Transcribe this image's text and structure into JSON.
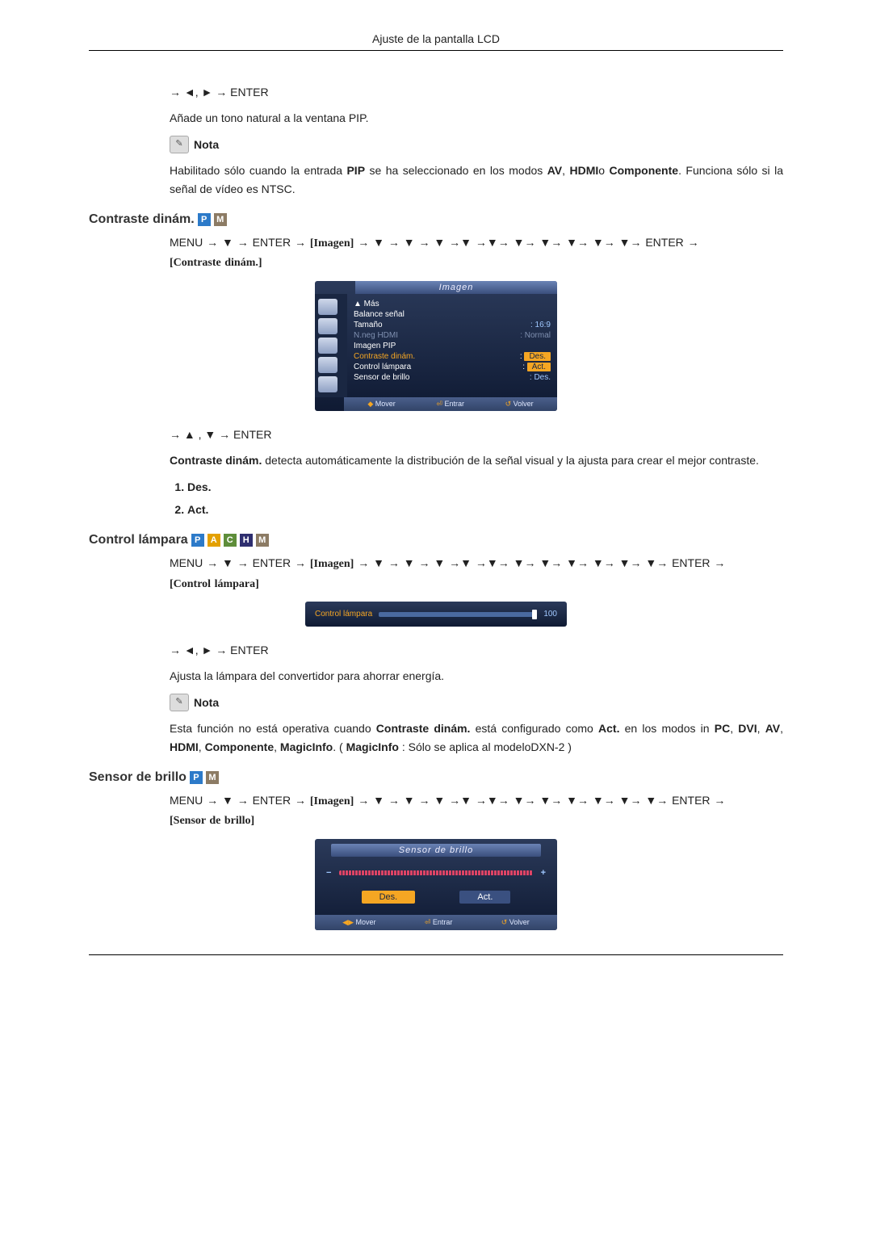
{
  "header": {
    "title": "Ajuste de la pantalla LCD"
  },
  "s0": {
    "nav": "→ ◄, ► → ENTER",
    "desc": "Añade un tono natural a la ventana PIP.",
    "note_label": "Nota",
    "note_body_1": "Habilitado sólo cuando la entrada ",
    "note_b1": "PIP",
    "note_body_2": " se ha seleccionado en los modos ",
    "note_b2": "AV",
    "note_body_3": ", ",
    "note_b3": "HDMI",
    "note_body_4": "o ",
    "note_b4": "Componente",
    "note_body_5": ". Funciona sólo si la señal de vídeo es NTSC."
  },
  "s1": {
    "heading": "Contraste dinám.",
    "path_pre": "MENU → ▼ → ENTER → ",
    "path_img": "[Imagen]",
    "path_mid": " → ▼ → ▼ → ▼ →▼ →▼→ ▼→ ▼→ ▼→ ▼→ ▼→ ENTER → ",
    "path_end": "[Contraste dinám.]",
    "nav2": "→ ▲ , ▼ → ENTER",
    "desc_b": "Contraste dinám.",
    "desc": " detecta automáticamente la distribución de la señal visual y la ajusta para crear el mejor contraste.",
    "opt1": "Des.",
    "opt2": "Act."
  },
  "osd1": {
    "title": "Imagen",
    "more": "▲ Más",
    "rows": [
      {
        "k": "Balance señal",
        "v": ""
      },
      {
        "k": "Tamaño",
        "v": "16:9"
      },
      {
        "k": "N.neg HDMI",
        "v": "Normal",
        "dim": true
      },
      {
        "k": "Imagen PIP",
        "v": ""
      },
      {
        "k": "Contraste dinám.",
        "v": "Des.",
        "hl": true
      },
      {
        "k": "Control lámpara",
        "v": "Act."
      },
      {
        "k": "Sensor de brillo",
        "v": "Des."
      }
    ],
    "foot_move": "Mover",
    "foot_enter": "Entrar",
    "foot_return": "Volver"
  },
  "s2": {
    "heading": "Control lámpara",
    "path_pre": "MENU → ▼ → ENTER → ",
    "path_img": "[Imagen]",
    "path_mid": " → ▼ → ▼ → ▼ →▼ →▼→ ▼→ ▼→ ▼→ ▼→ ▼→ ▼→ ENTER → ",
    "path_end": "[Control lámpara]",
    "nav2": "→ ◄, ► → ENTER",
    "desc": "Ajusta la lámpara del convertidor para ahorrar energía.",
    "note_label": "Nota",
    "note_l1": "Esta función no está operativa cuando ",
    "note_b1": "Contraste dinám.",
    "note_l2": " está configurado como ",
    "note_b2": "Act.",
    "note_l3": " en los modos in ",
    "note_b3": "PC",
    "note_b4": "DVI",
    "note_b5": "AV",
    "note_b6": "HDMI",
    "note_b7": "Componente",
    "note_b8": "MagicInfo",
    "note_l4": ". ( ",
    "note_b9": "MagicInfo",
    "note_l5": " : Sólo se aplica al modeloDXN-2 )"
  },
  "osd2": {
    "label": "Control lámpara",
    "value": "100"
  },
  "s3": {
    "heading": "Sensor de brillo",
    "path_pre": "MENU → ▼ → ENTER → ",
    "path_img": "[Imagen]",
    "path_mid": " → ▼ → ▼ → ▼ →▼ →▼→ ▼→ ▼→ ▼→ ▼→ ▼→ ▼→ ENTER → ",
    "path_end": "[Sensor de brillo]"
  },
  "osd3": {
    "title": "Sensor de brillo",
    "btn_off": "Des.",
    "btn_on": "Act.",
    "foot_move": "Mover",
    "foot_enter": "Entrar",
    "foot_return": "Volver"
  }
}
